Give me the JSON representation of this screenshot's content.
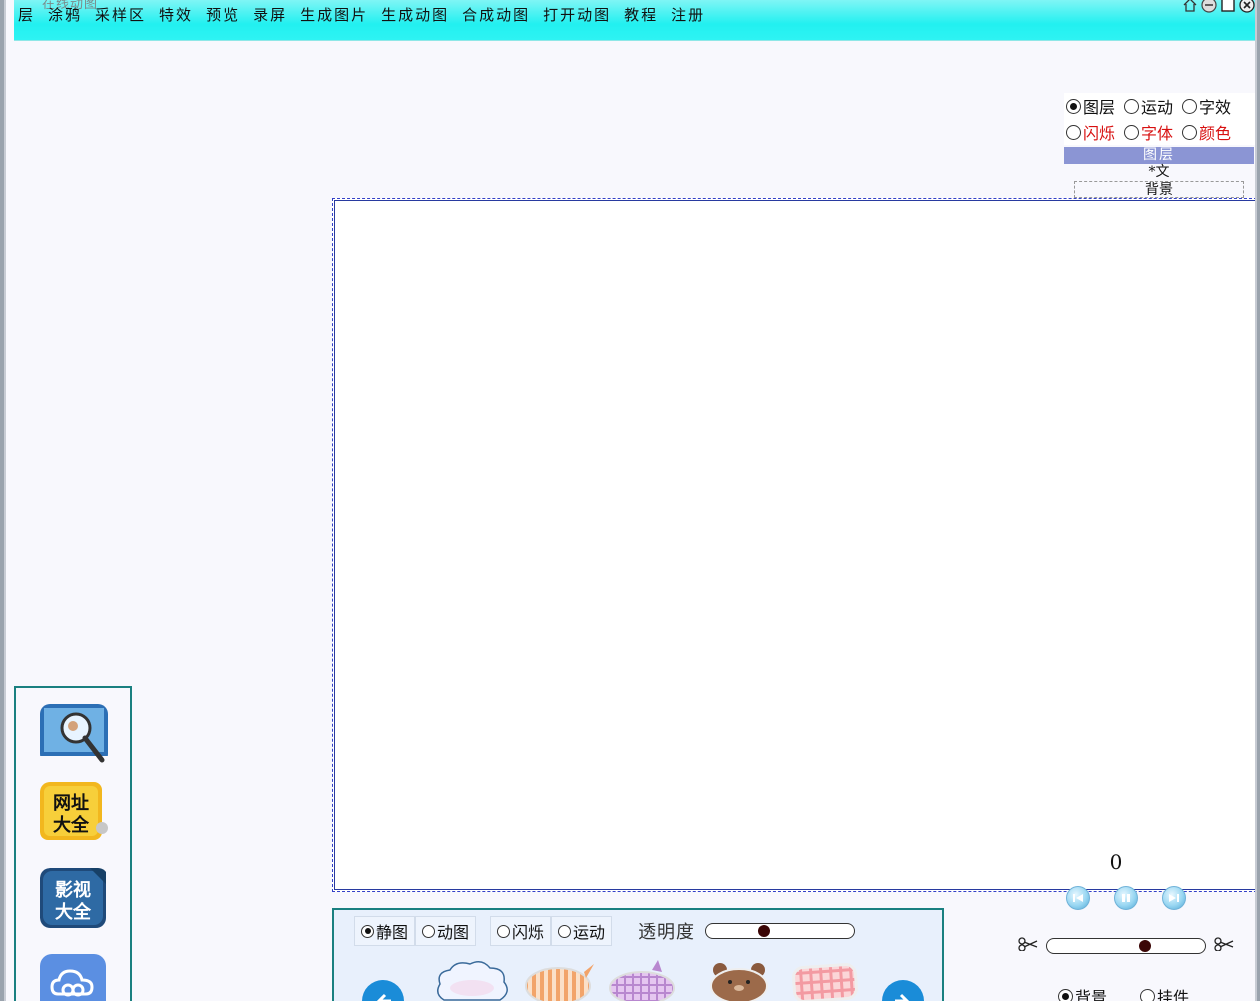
{
  "window": {
    "ghost_title": "在线动图"
  },
  "menu": {
    "items": [
      "层",
      "涂鸦",
      "采样区",
      "特效",
      "预览",
      "录屏",
      "生成图片",
      "生成动图",
      "合成动图",
      "打开动图",
      "教程",
      "注册"
    ]
  },
  "window_controls": [
    "home-icon",
    "minimize-icon",
    "maximize-icon",
    "close-icon"
  ],
  "layer_panel": {
    "row1": [
      {
        "label": "图层",
        "checked": true,
        "color": "#111111"
      },
      {
        "label": "运动",
        "checked": false,
        "color": "#111111"
      },
      {
        "label": "字效",
        "checked": false,
        "color": "#111111"
      }
    ],
    "row2": [
      {
        "label": "闪烁",
        "checked": false,
        "color": "#d81010"
      },
      {
        "label": "字体",
        "checked": false,
        "color": "#d81010"
      },
      {
        "label": "颜色",
        "checked": false,
        "color": "#d81010"
      }
    ],
    "header": "图层",
    "layers": [
      "*文",
      "背景"
    ]
  },
  "playback": {
    "frame_count": "0",
    "buttons": [
      "rewind-icon",
      "pause-icon",
      "forward-icon"
    ],
    "speed_level": 0.63
  },
  "bg_options": [
    {
      "label": "背景",
      "checked": true
    },
    {
      "label": "挂件",
      "checked": false
    }
  ],
  "bottom_panel": {
    "mode_options": [
      {
        "label": "静图",
        "checked": true
      },
      {
        "label": "动图",
        "checked": false
      }
    ],
    "effect_options": [
      {
        "label": "闪烁",
        "checked": false
      },
      {
        "label": "运动",
        "checked": false
      }
    ],
    "opacity_label": "透明度",
    "opacity_level": 0.38,
    "stickers": [
      "cloud-bubble",
      "striped-bubble",
      "plaid-bubble",
      "bear-bubble",
      "pink-plaid-bubble"
    ]
  },
  "sidebar": {
    "apps": [
      {
        "name": "search-app",
        "label": ""
      },
      {
        "name": "url-directory-app",
        "label": "网址大全"
      },
      {
        "name": "video-app",
        "label": "影视大全"
      },
      {
        "name": "cloud-app",
        "label": ""
      }
    ]
  },
  "colors": {
    "menubar": "#22f0f0",
    "canvas_border": "#283aa0",
    "panel_border": "#1a8080",
    "layer_header": "#8b95d4",
    "accent_red": "#d81010"
  }
}
